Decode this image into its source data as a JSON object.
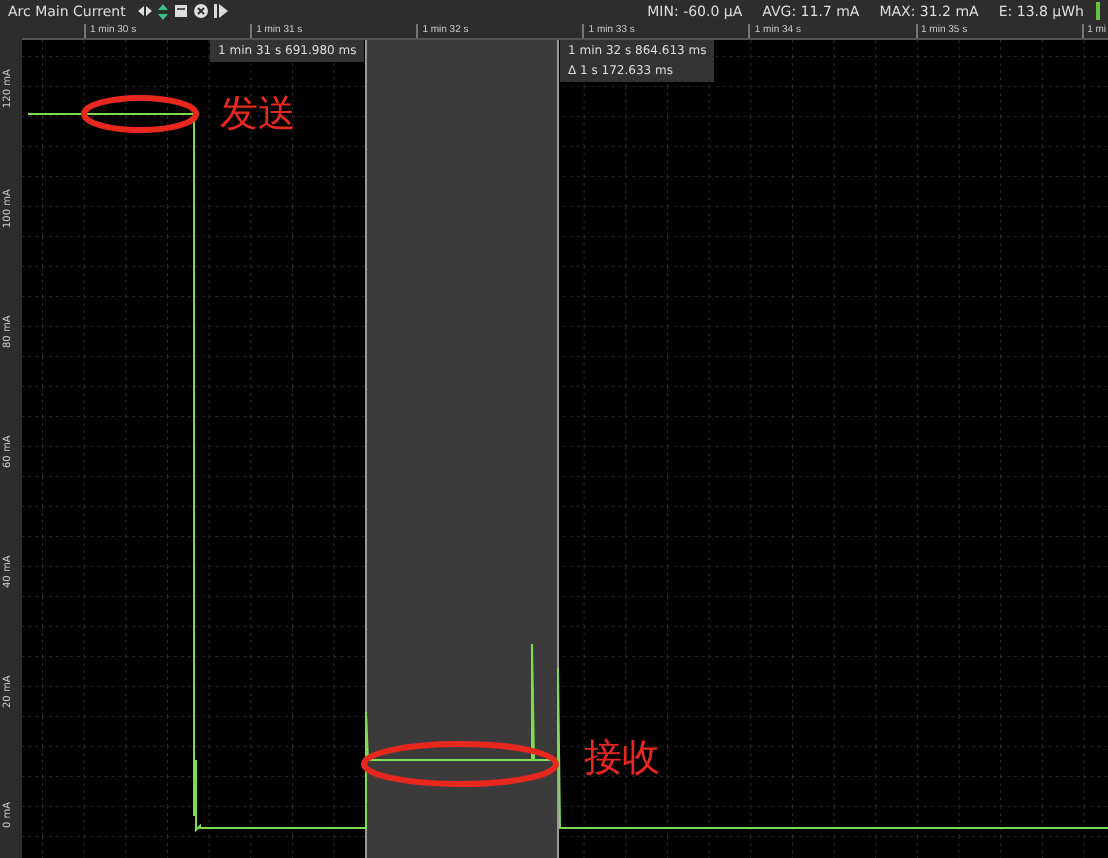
{
  "channel": {
    "title": "Arc Main Current"
  },
  "stats": [
    {
      "label": "MIN: -60.0 µA"
    },
    {
      "label": "AVG: 11.7 mA"
    },
    {
      "label": "MAX: 31.2 mA"
    },
    {
      "label": "E: 13.8 µWh"
    }
  ],
  "time_axis": {
    "ticks": [
      "1 min 30 s",
      "1 min 31 s",
      "1 min 32 s",
      "1 min 33 s",
      "1 min 34 s",
      "1 min 35 s",
      "1 mi"
    ]
  },
  "y_axis": {
    "ticks": [
      "120 mA",
      "100 mA",
      "80 mA",
      "60 mA",
      "40 mA",
      "20 mA",
      "0 mA"
    ]
  },
  "cursors": [
    {
      "time": "1 min 31 s 691.980 ms"
    },
    {
      "time": "1 min 32 s 864.613 ms",
      "delta": "Δ 1 s 172.633 ms"
    }
  ],
  "annotations": [
    {
      "text": "发送"
    },
    {
      "text": "接收"
    }
  ]
}
